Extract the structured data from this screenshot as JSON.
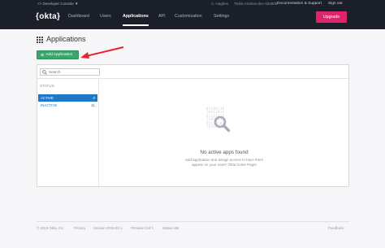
{
  "topbar": {
    "console_switch": "<> Developer Console ▼",
    "user_name": "A. Hughes",
    "user_org": "Twilio-Andrew-dev-333806",
    "docs_link": "Documentation & Support",
    "signout_link": "Sign out",
    "logo_text": "{okta}",
    "nav": [
      "Dashboard",
      "Users",
      "Applications",
      "API",
      "Customization",
      "Settings"
    ],
    "active_nav": "Applications",
    "upgrade_label": "Upgrade"
  },
  "page": {
    "title": "Applications",
    "add_button_label": "Add Application",
    "add_button_icon": "plus-icon"
  },
  "panel": {
    "search_placeholder": "Search",
    "status_header": "STATUS",
    "statuses": [
      {
        "label": "ACTIVE",
        "count": "0"
      },
      {
        "label": "INACTIVE",
        "count": "31"
      }
    ],
    "empty_title": "No active apps found",
    "empty_desc": "Add application and assign access to have them appear on your users' Okta home Page!",
    "binary_art": "01100110\n10011011\n01101110\n11001010\n01110101\n10100110"
  },
  "footer": {
    "copyright": "© 2019 Okta, Inc.",
    "privacy": "Privacy",
    "version": "Version 2019.03.1",
    "cell": "Preview Cell 1",
    "status_site": "Status site",
    "feedback": "Feedback"
  },
  "colors": {
    "topbar_bg": "#1a1f2a",
    "upgrade": "#e0246a",
    "add_button": "#3ba56c",
    "active_blue": "#1f77c7",
    "annotation_arrow": "#e3262b"
  }
}
